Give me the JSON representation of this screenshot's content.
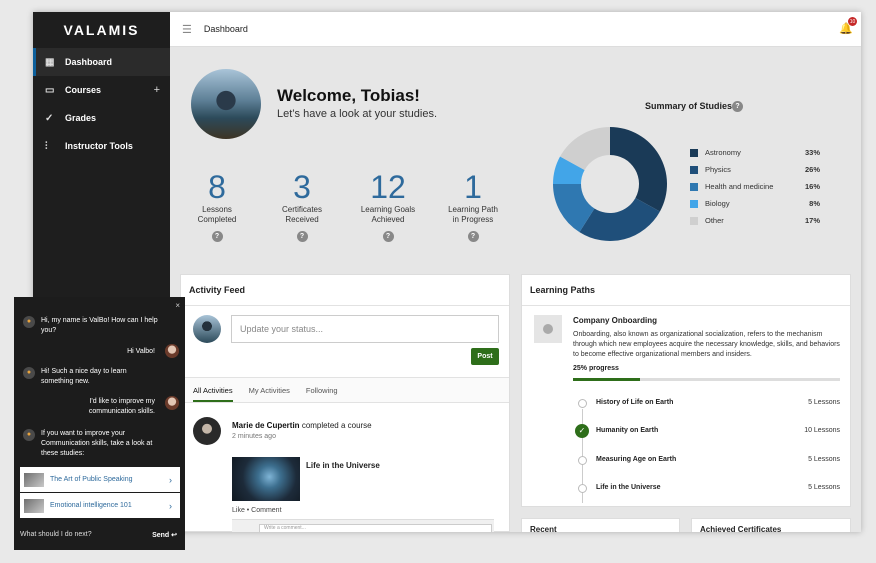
{
  "app": {
    "logo": "VALAMIS"
  },
  "sidebar": {
    "items": [
      {
        "label": "Dashboard",
        "icon": "dashboard-icon"
      },
      {
        "label": "Courses",
        "icon": "book-icon"
      },
      {
        "label": "Grades",
        "icon": "check-icon"
      },
      {
        "label": "Instructor Tools",
        "icon": "sliders-icon"
      }
    ],
    "courses_add": "+"
  },
  "topbar": {
    "title": "Dashboard",
    "notifications": "10"
  },
  "welcome": {
    "title": "Welcome, Tobias!",
    "subtitle": "Let’s have a look at your studies."
  },
  "stats": [
    {
      "value": "8",
      "label1": "Lessons",
      "label2": "Completed"
    },
    {
      "value": "3",
      "label1": "Certificates",
      "label2": "Received"
    },
    {
      "value": "12",
      "label1": "Learning Goals",
      "label2": "Achieved"
    },
    {
      "value": "1",
      "label1": "Learning Path",
      "label2": "in Progress"
    }
  ],
  "help_glyph": "?",
  "summary": {
    "title": "Summary of Studies",
    "items": [
      {
        "label": "Astronomy",
        "pct": "33%",
        "value": 33,
        "color": "#1a3a57"
      },
      {
        "label": "Physics",
        "pct": "26%",
        "value": 26,
        "color": "#1f4f7a"
      },
      {
        "label": "Health and medicine",
        "pct": "16%",
        "value": 16,
        "color": "#2f78b1"
      },
      {
        "label": "Biology",
        "pct": "8%",
        "value": 8,
        "color": "#42a5e8"
      },
      {
        "label": "Other",
        "pct": "17%",
        "value": 17,
        "color": "#cfcfcf"
      }
    ]
  },
  "feed": {
    "title": "Activity Feed",
    "status_placeholder": "Update your status...",
    "post_label": "Post",
    "tabs": [
      "All Activities",
      "My Activities",
      "Following"
    ],
    "post": {
      "author": "Marie de Cupertin",
      "action": "completed a course",
      "time": "2 minutes ago",
      "course": "Life in the Universe",
      "actions": "Like • Comment",
      "comment_placeholder": "Write a comment..."
    }
  },
  "learning_paths": {
    "title": "Learning Paths",
    "name": "Company Onboarding",
    "description": "Onboarding, also known as organizational socialization, refers to the mechanism through which new employees acquire the necessary knowledge, skills, and behaviors to become effective organizational members and insiders.",
    "progress_label": "25% progress",
    "progress": 0.25,
    "steps": [
      {
        "title": "History of Life on Earth",
        "count": "5 Lessons",
        "done": false
      },
      {
        "title": "Humanity on Earth",
        "count": "10 Lessons",
        "done": true
      },
      {
        "title": "Measuring Age on Earth",
        "count": "5 Lessons",
        "done": false
      },
      {
        "title": "Life in the Universe",
        "count": "5 Lessons",
        "done": false
      }
    ]
  },
  "bottom_cards": {
    "recent": "Recent",
    "certs": "Achieved Certificates"
  },
  "chat": {
    "close": "×",
    "messages": [
      {
        "from": "bot",
        "text": "Hi, my name is ValBo! How can I help you?"
      },
      {
        "from": "user",
        "text": "Hi Valbo!"
      },
      {
        "from": "bot",
        "text": "Hi! Such a nice day to learn something new."
      },
      {
        "from": "user",
        "text": "I'd like to improve my communication skills."
      },
      {
        "from": "bot",
        "text": "If you want to improve your Communication skills, take a look at these studies:"
      }
    ],
    "links": [
      "The Art of Public Speaking",
      "Emotional intelligence 101"
    ],
    "input_placeholder": "What should I do next?",
    "send": "Send ↩"
  }
}
